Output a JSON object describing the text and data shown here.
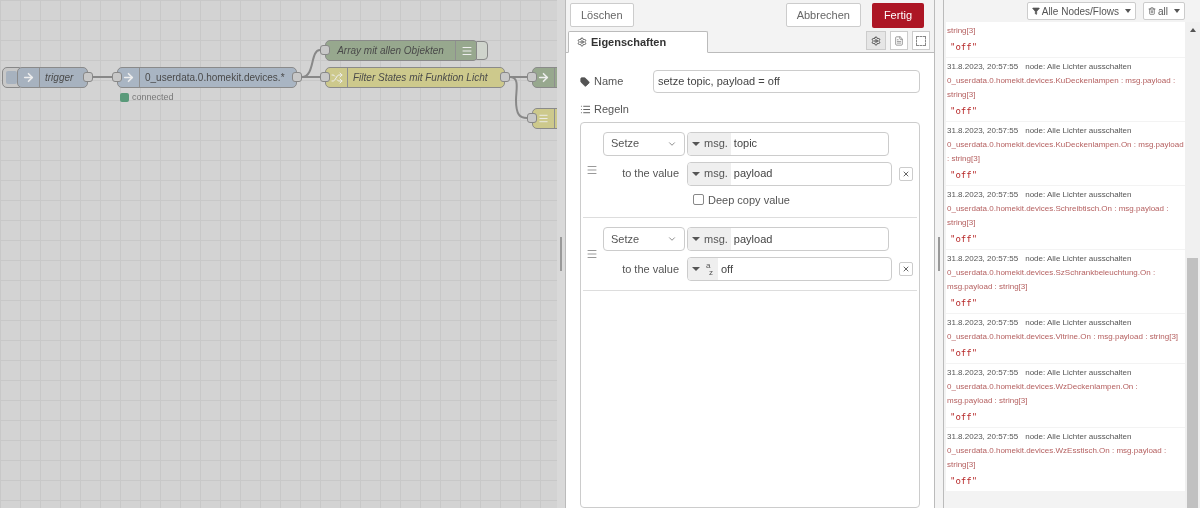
{
  "canvas": {
    "nodes": [
      {
        "kind": "inject",
        "label": "trigger"
      },
      {
        "kind": "input",
        "label": "0_userdata.0.homekit.devices.*",
        "status": "connected"
      },
      {
        "kind": "debug",
        "label": "Array mit allen Objekten"
      },
      {
        "kind": "switch",
        "label": "Filter States mit Funktion Licht"
      },
      {
        "kind": "function"
      },
      {
        "kind": "split"
      }
    ]
  },
  "tray": {
    "buttons": {
      "delete": "Löschen",
      "cancel": "Abbrechen",
      "done": "Fertig"
    },
    "tabs": [
      {
        "label": "Eigenschaften",
        "selected": true
      }
    ],
    "name_label": "Name",
    "name_value": "setze topic, payload = off",
    "rules_label": "Regeln",
    "rules": [
      {
        "action": "Setze",
        "target_type": "msg.",
        "target": "topic",
        "value_label": "to the value",
        "kind": "msg",
        "value_type": "msg.",
        "value": "payload",
        "deep_copy": {
          "label": "Deep copy value",
          "checked": false
        }
      },
      {
        "action": "Setze",
        "target_type": "msg.",
        "target": "payload",
        "value_label": "to the value",
        "kind": "str",
        "value_type_top": "a",
        "value_type_bottom": "z",
        "value": "off"
      }
    ]
  },
  "debug": {
    "filter": "Alle Nodes/Flows",
    "clear": "all",
    "messages": [
      {
        "topic": "string[3]",
        "value": "\"off\""
      },
      {
        "time": "31.8.2023, 20:57:55",
        "node": "node: Alle Lichter ausschalten",
        "topic": "0_userdata.0.homekit.devices.KuDeckenlampen : msg.payload : string[3]",
        "value": "\"off\""
      },
      {
        "time": "31.8.2023, 20:57:55",
        "node": "node: Alle Lichter ausschalten",
        "topic": "0_userdata.0.homekit.devices.KuDeckenlampen.On : msg.payload : string[3]",
        "value": "\"off\""
      },
      {
        "time": "31.8.2023, 20:57:55",
        "node": "node: Alle Lichter ausschalten",
        "topic": "0_userdata.0.homekit.devices.Schreibtisch.On : msg.payload : string[3]",
        "value": "\"off\""
      },
      {
        "time": "31.8.2023, 20:57:55",
        "node": "node: Alle Lichter ausschalten",
        "topic": "0_userdata.0.homekit.devices.SzSchrankbeleuchtung.On : msg.payload : string[3]",
        "value": "\"off\""
      },
      {
        "time": "31.8.2023, 20:57:55",
        "node": "node: Alle Lichter ausschalten",
        "topic": "0_userdata.0.homekit.devices.Vitrine.On : msg.payload : string[3]",
        "value": "\"off\""
      },
      {
        "time": "31.8.2023, 20:57:55",
        "node": "node: Alle Lichter ausschalten",
        "topic": "0_userdata.0.homekit.devices.WzDeckenlampen.On : msg.payload : string[3]",
        "value": "\"off\""
      },
      {
        "time": "31.8.2023, 20:57:55",
        "node": "node: Alle Lichter ausschalten",
        "topic": "0_userdata.0.homekit.devices.WzEsstisch.On : msg.payload : string[3]",
        "value": "\"off\""
      }
    ]
  }
}
